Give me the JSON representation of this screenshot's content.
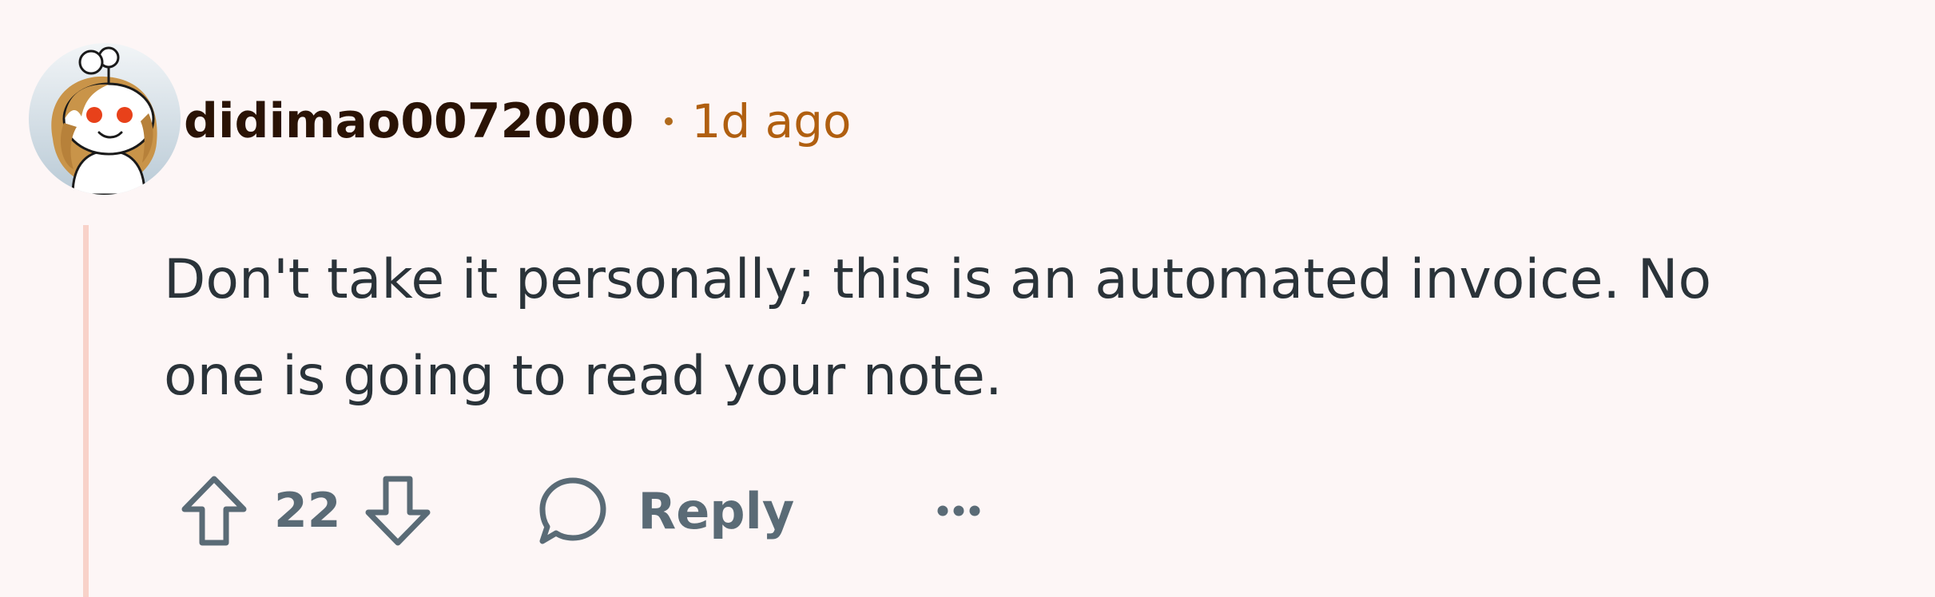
{
  "comment": {
    "author": "didimao0072000",
    "separator": "•",
    "timestamp": "1d ago",
    "body_lines": [
      "Don't take it personally; this is an automated invoice. No",
      "one is going to read your note."
    ],
    "score": "22",
    "reply_label": "Reply",
    "avatar_icon": "snoo-avatar-icon",
    "more_icon": "more-options-icon"
  },
  "colors": {
    "background": "#fdf6f6",
    "thread_line": "#f8d2c9",
    "username": "#2a1305",
    "timestamp": "#b05f10",
    "body_text": "#2a3339",
    "action_gray": "#5a6b76"
  }
}
